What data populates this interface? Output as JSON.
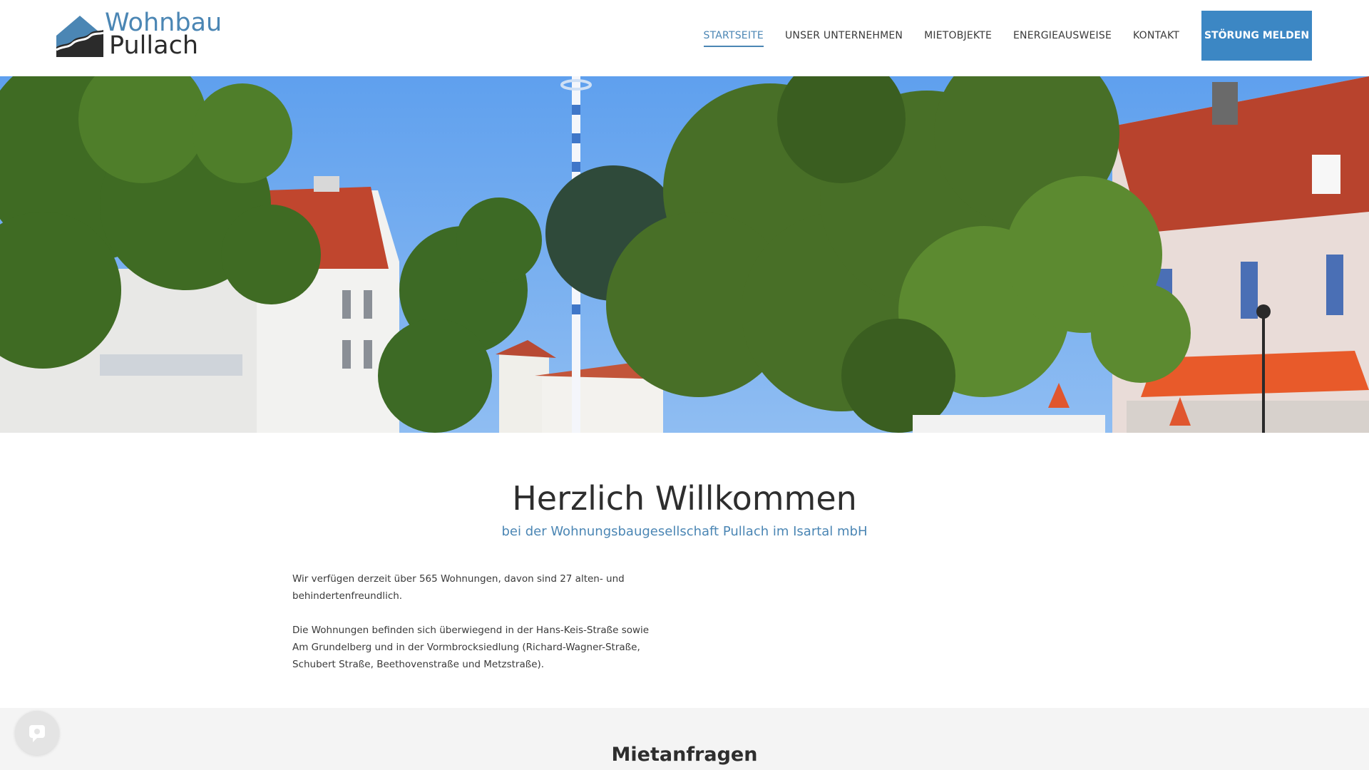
{
  "brand": {
    "name_line1": "Wohnbau",
    "name_line2": "Pullach",
    "colors": {
      "accent": "#4b86b4",
      "cta": "#3c87c4",
      "text": "#333333",
      "section_bg": "#f4f4f4"
    }
  },
  "nav": {
    "items": [
      {
        "label": "STARTSEITE",
        "active": true
      },
      {
        "label": "UNSER UNTERNEHMEN",
        "active": false
      },
      {
        "label": "MIETOBJEKTE",
        "active": false
      },
      {
        "label": "ENERGIEAUSWEISE",
        "active": false
      },
      {
        "label": "KONTAKT",
        "active": false
      }
    ],
    "cta_label": "STÖRUNG MELDEN"
  },
  "hero": {
    "image": "hero-photo"
  },
  "welcome": {
    "title": "Herzlich Willkommen",
    "subtitle": "bei der Wohnungsbaugesellschaft Pullach im Isartal mbH",
    "paragraphs": [
      "Wir verfügen derzeit über 565 Wohnungen, davon sind 27 alten- und behindertenfreundlich.",
      "Die Wohnungen befinden sich überwiegend in der Hans-Keis-Straße sowie Am Grundelberg und in der Vormbrocksiedlung (Richard-Wagner-Straße, Schubert Straße, Beethovenstraße und Metzstraße)."
    ]
  },
  "section": {
    "title": "Mietanfragen"
  },
  "chat": {
    "icon": "chat-icon"
  }
}
